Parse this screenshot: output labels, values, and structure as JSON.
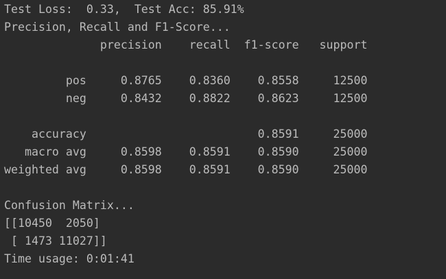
{
  "console": {
    "lines": [
      "Test Loss:  0.33,  Test Acc: 85.91%",
      "Precision, Recall and F1-Score...",
      "              precision    recall  f1-score   support",
      "",
      "         pos     0.8765    0.8360    0.8558     12500",
      "         neg     0.8432    0.8822    0.8623     12500",
      "",
      "    accuracy                         0.8591     25000",
      "   macro avg     0.8598    0.8591    0.8590     25000",
      "weighted avg     0.8598    0.8591    0.8590     25000",
      "",
      "Confusion Matrix...",
      "[[10450  2050]",
      " [ 1473 11027]]",
      "Time usage: 0:01:41"
    ]
  }
}
